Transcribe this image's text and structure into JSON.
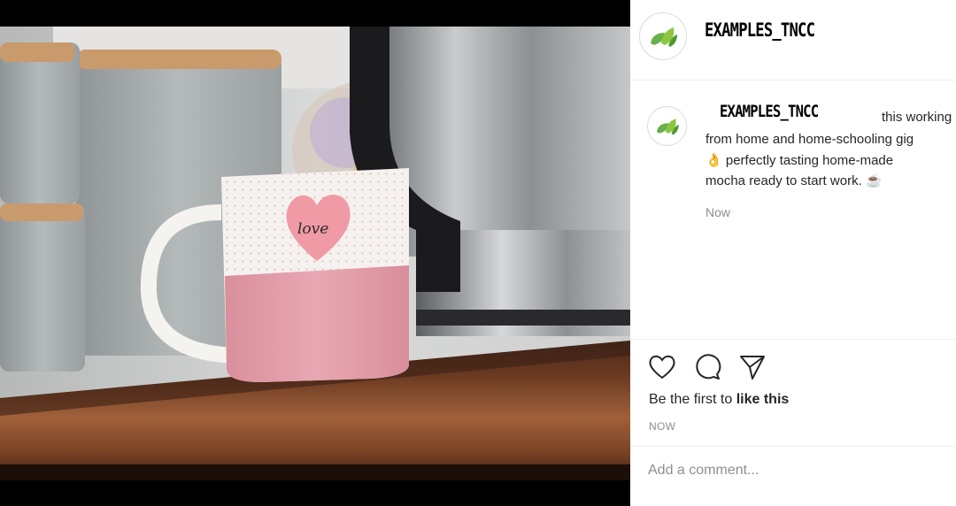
{
  "post": {
    "image_label": "love",
    "account": {
      "username": "EXAMPLES_TNCC",
      "logo": "leaf-logo-icon"
    },
    "caption": {
      "username": "EXAMPLES_TNCC",
      "text_line1": "this working",
      "text_line2": "from home and home-schooling gig",
      "text_line3": "perfectly tasting home-made",
      "text_line4": "mocha ready to start work.",
      "emoji_ok": "👌",
      "emoji_coffee": "☕",
      "timestamp": "Now"
    },
    "actions": {
      "icons": [
        "heart-icon",
        "comment-icon",
        "share-icon"
      ]
    },
    "likes": {
      "prefix": "Be the first to ",
      "cta": "like this"
    },
    "posted_time": "NOW",
    "comment": {
      "placeholder": "Add a comment..."
    }
  },
  "colors": {
    "brand_green": "#6ab04c",
    "text": "#262626",
    "muted": "#8e8e8e",
    "border": "#efefef"
  }
}
